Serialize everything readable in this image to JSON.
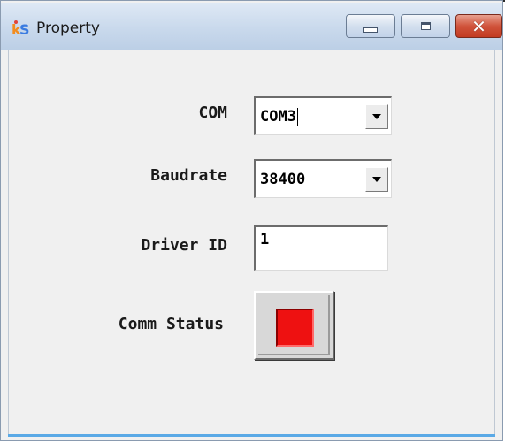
{
  "window": {
    "title": "Property",
    "icon": "ks-app-icon",
    "controls": {
      "minimize_icon": "minimize-icon",
      "maximize_icon": "maximize-icon",
      "close_glyph": "✕"
    }
  },
  "form": {
    "com": {
      "label": "COM",
      "value": "COM3"
    },
    "baudrate": {
      "label": "Baudrate",
      "value": "38400"
    },
    "driver_id": {
      "label": "Driver ID",
      "value": "1"
    },
    "comm_status": {
      "label": "Comm Status",
      "state_color": "#ee1111"
    }
  },
  "colors": {
    "accent": "#5aa9e6",
    "close_button": "#c23b22",
    "status_red": "#ee1111"
  }
}
